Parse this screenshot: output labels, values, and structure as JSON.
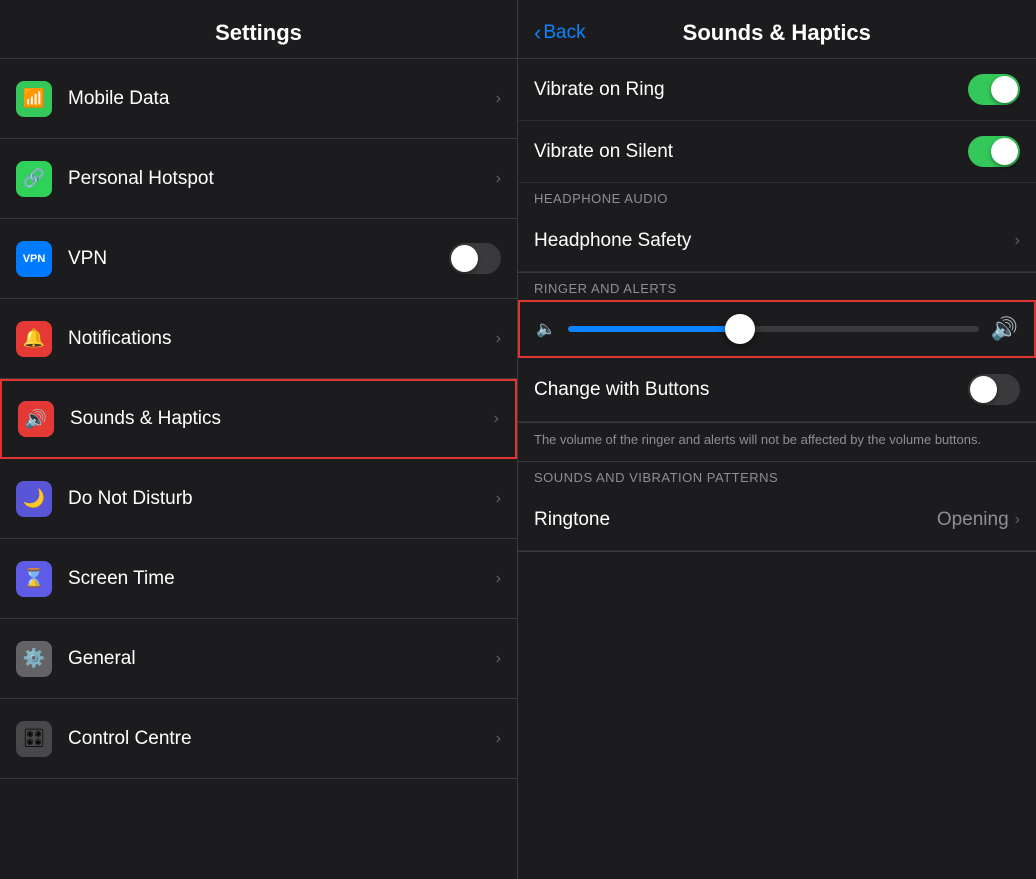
{
  "left": {
    "header": "Settings",
    "items": [
      {
        "id": "mobile-data",
        "label": "Mobile Data",
        "icon": "📶",
        "iconClass": "icon-green",
        "hasChevron": true,
        "hasToggle": false,
        "active": false
      },
      {
        "id": "personal-hotspot",
        "label": "Personal Hotspot",
        "icon": "🔗",
        "iconClass": "icon-green2",
        "hasChevron": true,
        "hasToggle": false,
        "active": false
      },
      {
        "id": "vpn",
        "label": "VPN",
        "icon": "VPN",
        "iconClass": "icon-blue",
        "hasChevron": false,
        "hasToggle": true,
        "toggleOn": false,
        "active": false
      },
      {
        "id": "notifications",
        "label": "Notifications",
        "icon": "🔔",
        "iconClass": "icon-red",
        "hasChevron": true,
        "hasToggle": false,
        "active": false
      },
      {
        "id": "sounds-haptics",
        "label": "Sounds & Haptics",
        "icon": "🔊",
        "iconClass": "icon-red",
        "hasChevron": true,
        "hasToggle": false,
        "active": true
      },
      {
        "id": "do-not-disturb",
        "label": "Do Not Disturb",
        "icon": "🌙",
        "iconClass": "icon-indigo",
        "hasChevron": true,
        "hasToggle": false,
        "active": false
      },
      {
        "id": "screen-time",
        "label": "Screen Time",
        "icon": "⌛",
        "iconClass": "icon-purple",
        "hasChevron": true,
        "hasToggle": false,
        "active": false
      },
      {
        "id": "general",
        "label": "General",
        "icon": "⚙️",
        "iconClass": "icon-gray",
        "hasChevron": true,
        "hasToggle": false,
        "active": false
      },
      {
        "id": "control-centre",
        "label": "Control Centre",
        "icon": "🎛",
        "iconClass": "icon-gray2",
        "hasChevron": true,
        "hasToggle": false,
        "active": false
      }
    ]
  },
  "right": {
    "header": "Sounds & Haptics",
    "back_label": "Back",
    "vibrate_ring_label": "Vibrate on Ring",
    "vibrate_ring_on": true,
    "vibrate_silent_label": "Vibrate on Silent",
    "vibrate_silent_on": true,
    "headphone_section_header": "HEADPHONE AUDIO",
    "headphone_safety_label": "Headphone Safety",
    "ringer_section_header": "RINGER AND ALERTS",
    "slider_value": 42,
    "change_buttons_label": "Change with Buttons",
    "change_buttons_on": false,
    "footer_note": "The volume of the ringer and alerts will not be affected by the volume buttons.",
    "sounds_section_header": "SOUNDS AND VIBRATION PATTERNS",
    "ringtone_label": "Ringtone",
    "ringtone_value": "Opening"
  }
}
